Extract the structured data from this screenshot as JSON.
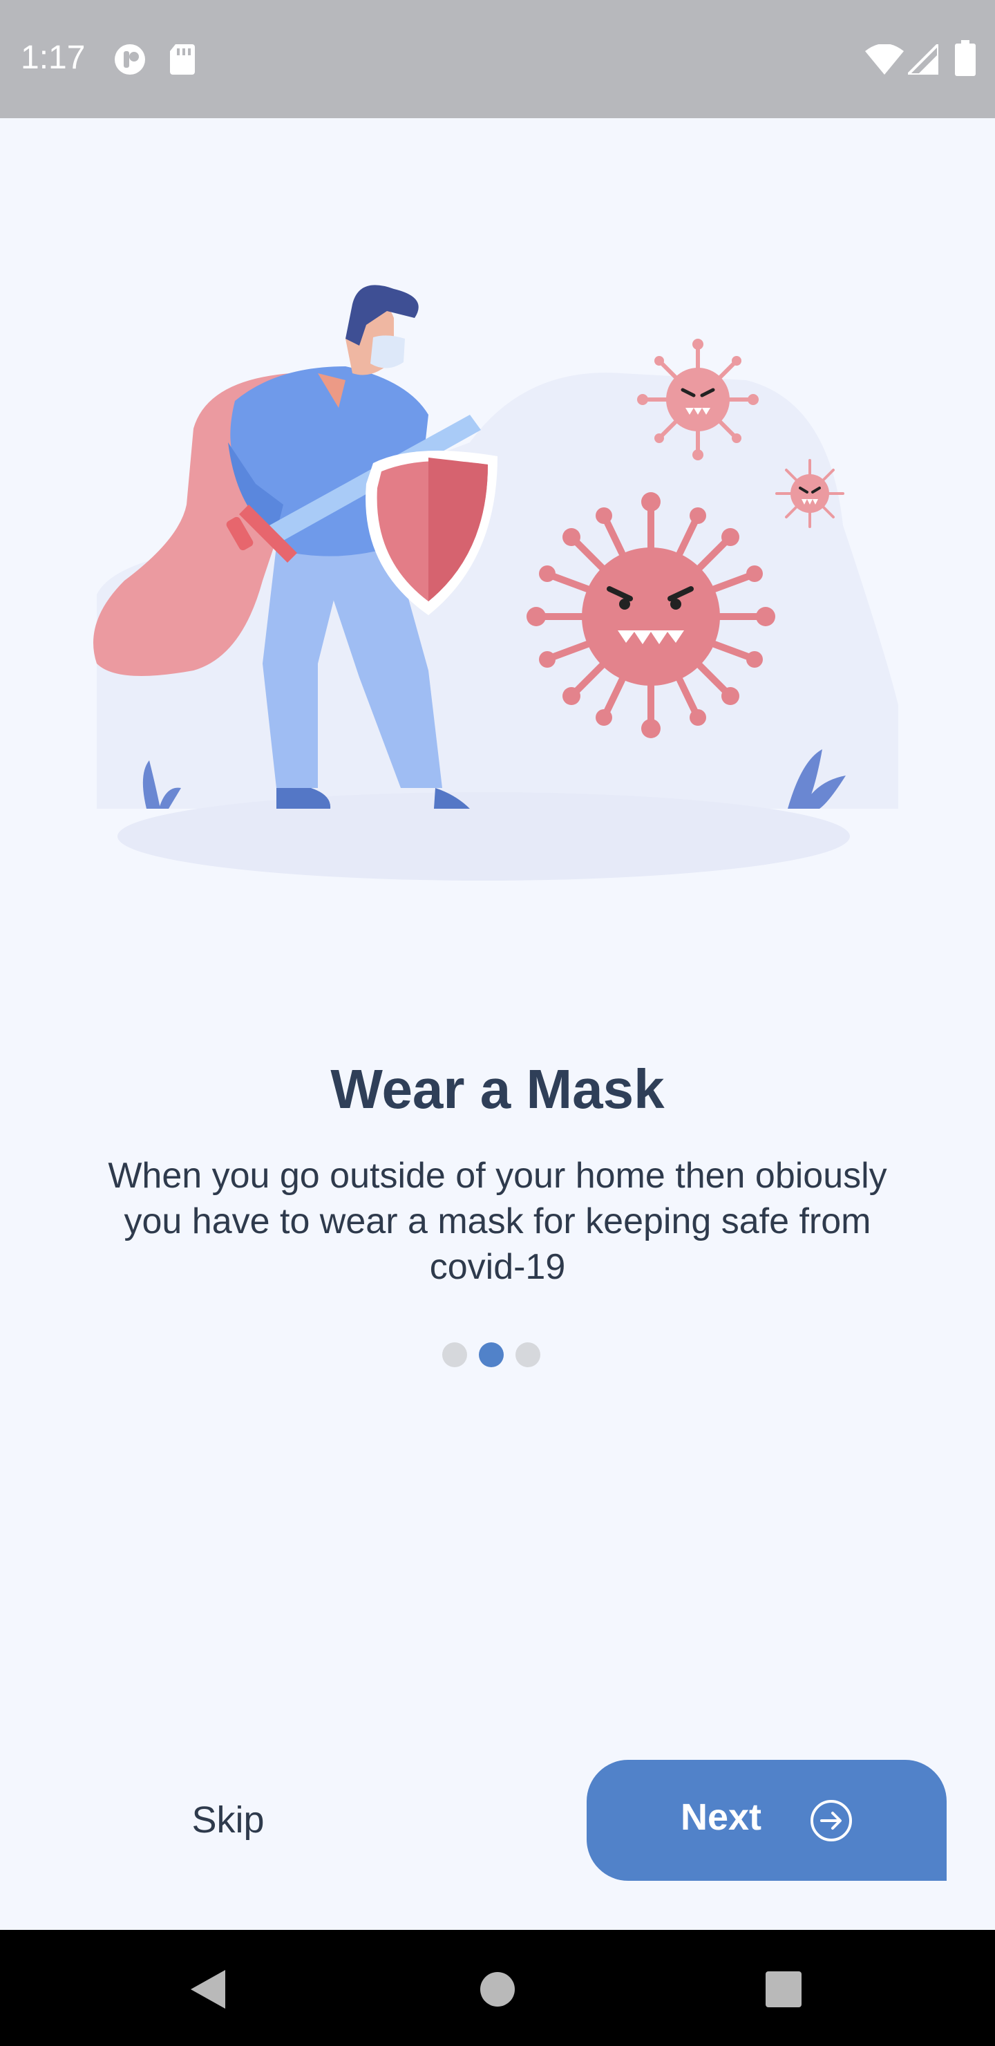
{
  "status_bar": {
    "time": "1:17",
    "icons": [
      "notification-app-icon",
      "sd-card-icon",
      "wifi-icon",
      "cellular-signal-icon",
      "battery-icon"
    ]
  },
  "onboarding": {
    "title": "Wear a Mask",
    "description": "When you go outside of your home then obiously you have to wear a mask for keeping safe from covid-19",
    "page_indicator": {
      "total": 3,
      "active_index": 1
    }
  },
  "actions": {
    "skip_label": "Skip",
    "next_label": "Next",
    "next_icon": "arrow-right-circle-icon"
  },
  "nav_bar": {
    "icons": [
      "back-icon",
      "home-icon",
      "recents-icon"
    ]
  },
  "colors": {
    "accent": "#5182c9",
    "title": "#2f3f58",
    "background": "#f4f7fe",
    "virus": "#e88a93"
  }
}
